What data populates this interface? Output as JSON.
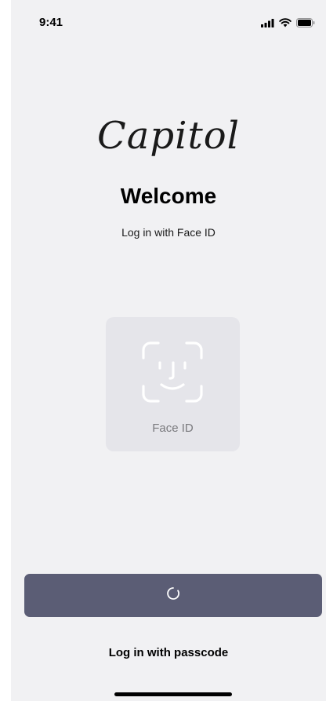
{
  "status_bar": {
    "time": "9:41",
    "icons": [
      "cellular-signal-icon",
      "wifi-icon",
      "battery-icon"
    ]
  },
  "brand": {
    "name": "Capitol"
  },
  "welcome": {
    "title": "Welcome",
    "subtitle": "Log in with Face ID"
  },
  "face_id": {
    "icon": "face-id-icon",
    "label": "Face ID"
  },
  "primary_button": {
    "state": "loading",
    "icon": "loading-spinner-icon"
  },
  "passcode_link": {
    "label": "Log in with passcode"
  },
  "colors": {
    "background": "#f1f1f3",
    "card": "#e5e5ea",
    "button": "#5b5d75",
    "face_id_glyph": "#ffffff"
  }
}
